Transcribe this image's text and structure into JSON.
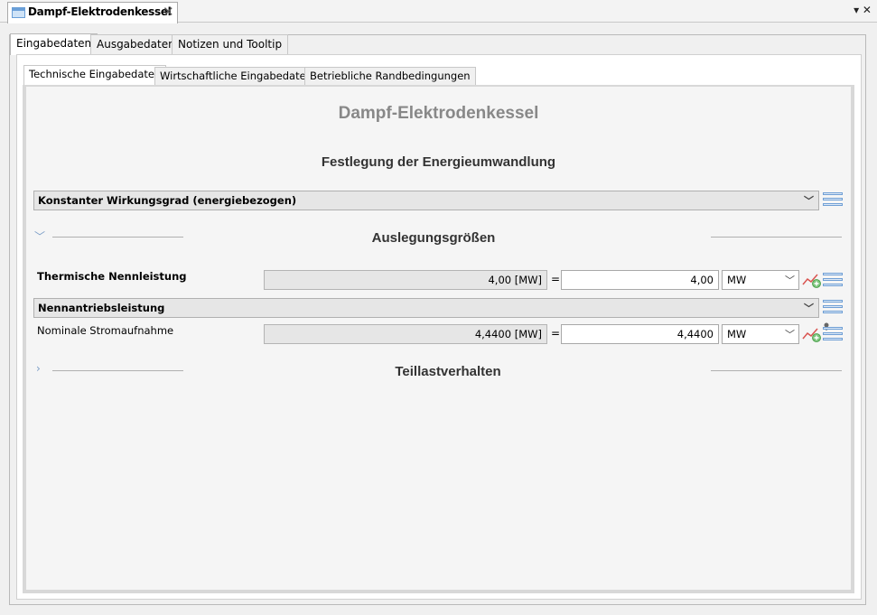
{
  "editor": {
    "tab_title": "Dampf-Elektrodenkessel",
    "window_buttons": "▾ ✕"
  },
  "outer_tabs": [
    "Eingabedaten",
    "Ausgabedaten",
    "Notizen und Tooltip"
  ],
  "inner_tabs": [
    "Technische Eingabedaten",
    "Wirtschaftliche Eingabedaten",
    "Betriebliche Randbedingungen"
  ],
  "main": {
    "title": "Dampf-Elektrodenkessel",
    "section_title": "Festlegung der Energieumwandlung",
    "conversion_select": "Konstanter Wirkungsgrad (energiebezogen)",
    "group1": {
      "title": "Auslegungsgrößen",
      "rows": [
        {
          "label": "Thermische Nennleistung",
          "computed": "4,00 [MW]",
          "eq": "=",
          "value": "4,00",
          "unit": "MW"
        }
      ],
      "drive_select": "Nennantriebsleistung",
      "rows2": [
        {
          "label": "Nominale Stromaufnahme",
          "computed": "4,4400 [MW]",
          "eq": "=",
          "value": "4,4400",
          "unit": "MW"
        }
      ]
    },
    "group2": {
      "title": "Teillastverhalten"
    }
  },
  "icons": {
    "tab_doc": "document-icon",
    "close": "close-icon",
    "list": "list-icon",
    "chart": "chart-add-icon",
    "chevron": "chevron-icon"
  },
  "colors": {
    "title_grey": "#888888",
    "accent_blue": "#6f9fd5"
  }
}
